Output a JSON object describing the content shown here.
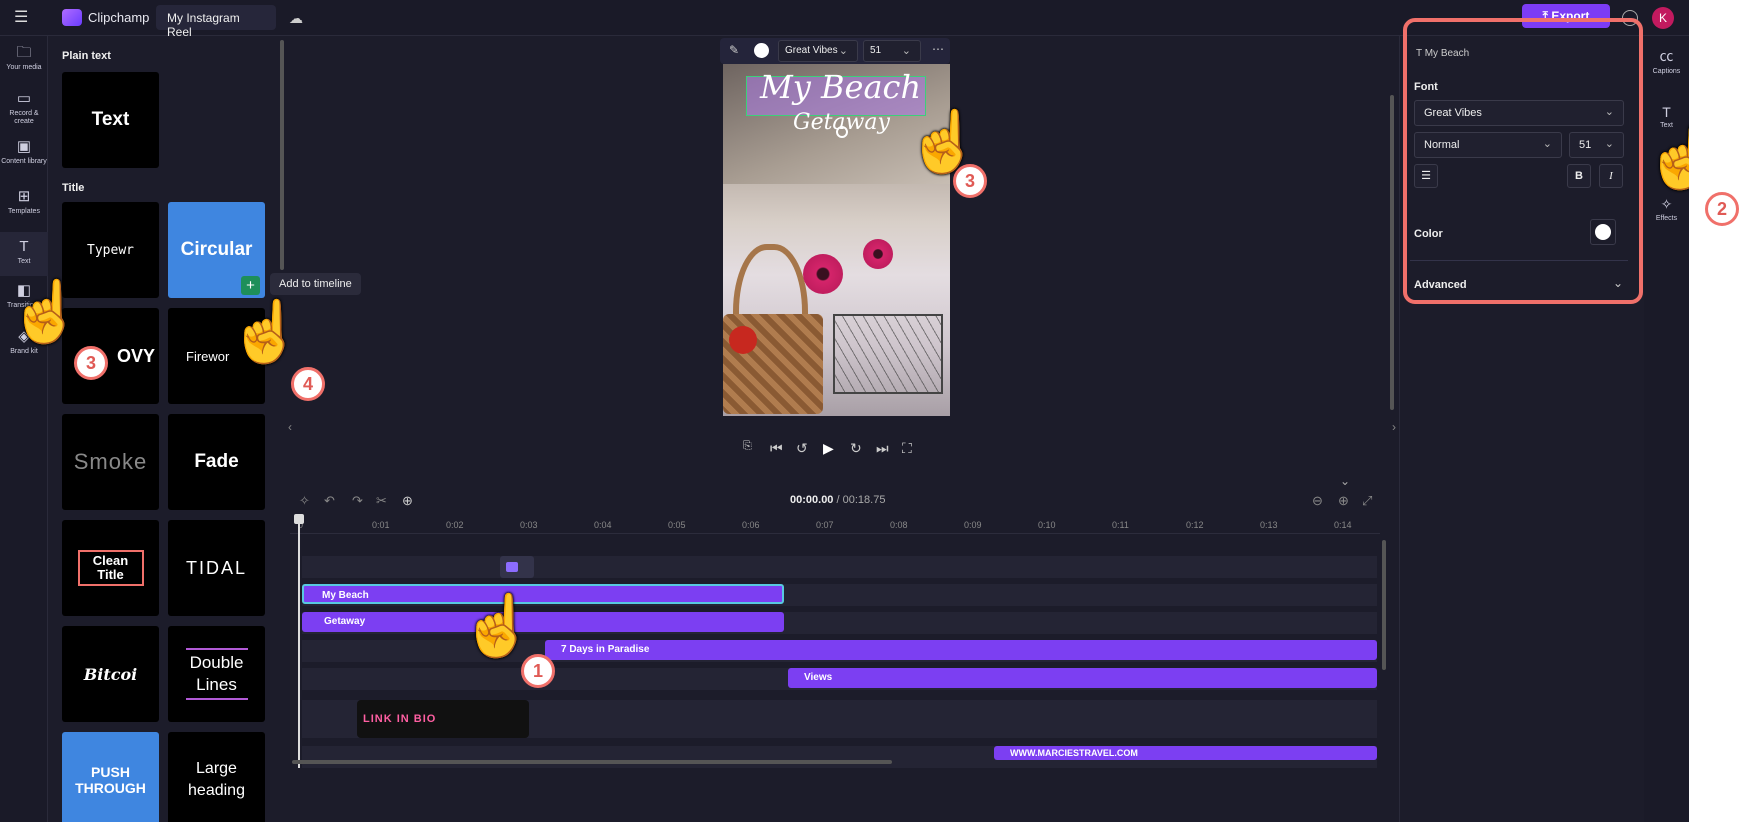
{
  "topbar": {
    "menu_icon": "hamburger-icon",
    "app_name": "Clipchamp",
    "project_name": "My Instagram Reel",
    "export_label": "Export",
    "avatar_initial": "K"
  },
  "left_rail": [
    {
      "label": "Your media",
      "icon": "folder-icon"
    },
    {
      "label": "Record & create",
      "icon": "camera-icon"
    },
    {
      "label": "Content library",
      "icon": "library-icon"
    },
    {
      "label": "Templates",
      "icon": "templates-icon"
    },
    {
      "label": "Text",
      "icon": "text-icon"
    },
    {
      "label": "Transitions",
      "icon": "transitions-icon"
    },
    {
      "label": "Brand kit",
      "icon": "brand-icon"
    }
  ],
  "text_panel": {
    "plain_text_heading": "Plain text",
    "plain_text_card": "Text",
    "title_heading": "Title",
    "cards": [
      "Typewr",
      "Circular",
      "OVY",
      "Firewor",
      "Smoke",
      "Fade",
      "Clean Title",
      "TIDAL",
      "Bitcoi",
      "Double Lines",
      "PUSH THROUGH",
      "Large heading"
    ],
    "tooltip": "Add to timeline"
  },
  "preview": {
    "font": "Great Vibes",
    "size": "51",
    "title_line1": "My Beach",
    "title_line2": "Getaway"
  },
  "timeline": {
    "time_current": "00:00.00",
    "time_total": "/ 00:18.75",
    "ticks": [
      "0",
      "0:01",
      "0:02",
      "0:03",
      "0:04",
      "0:05",
      "0:06",
      "0:07",
      "0:08",
      "0:09",
      "0:10",
      "0:11",
      "0:12",
      "0:13",
      "0:14"
    ],
    "tracks": [
      "My Beach",
      "Getaway",
      "7 Days in Paradise",
      "Views",
      "WWW.MARCIESTRAVEL.COM"
    ],
    "sticker_text": "LINK IN BIO"
  },
  "properties": {
    "item_name": "My Beach",
    "font_label": "Font",
    "font_value": "Great Vibes",
    "weight_value": "Normal",
    "size_value": "51",
    "bold": "B",
    "italic": "I",
    "color_label": "Color",
    "advanced_label": "Advanced"
  },
  "right_rail": [
    {
      "label": "Captions",
      "icon": "captions-icon"
    },
    {
      "label": "Text",
      "icon": "text-icon"
    },
    {
      "label": "Filters",
      "icon": "filters-icon"
    },
    {
      "label": "Effects",
      "icon": "effects-icon"
    }
  ],
  "annotations": [
    "1",
    "2",
    "3",
    "3",
    "4"
  ]
}
